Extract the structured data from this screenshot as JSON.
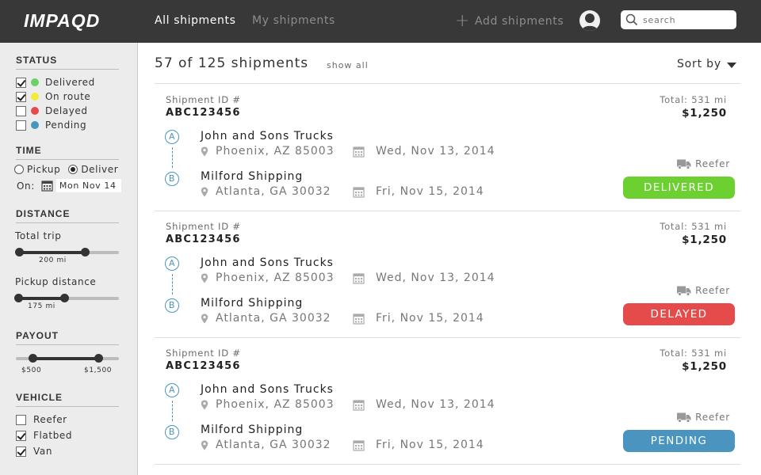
{
  "header": {
    "logo": "IMPAQD",
    "tabs": [
      {
        "label": "All shipments",
        "active": true
      },
      {
        "label": "My shipments",
        "active": false
      }
    ],
    "add_label": "Add shipments",
    "search_placeholder": "search"
  },
  "sidebar": {
    "status": {
      "heading": "STATUS",
      "items": [
        {
          "label": "Delivered",
          "checked": true,
          "color": "#6cd165"
        },
        {
          "label": "On route",
          "checked": true,
          "color": "#f3eb3a"
        },
        {
          "label": "Delayed",
          "checked": false,
          "color": "#e64b4b"
        },
        {
          "label": "Pending",
          "checked": false,
          "color": "#4a95c0"
        }
      ]
    },
    "time": {
      "heading": "TIME",
      "pickup_label": "Pickup",
      "deliver_label": "Deliver",
      "selected": "Deliver",
      "on_label": "On:",
      "date": "Mon Nov 14"
    },
    "distance": {
      "heading": "DISTANCE",
      "total_label": "Total trip",
      "total_value": "200 mi",
      "pickup_label": "Pickup distance",
      "pickup_value": "175 mi"
    },
    "payout": {
      "heading": "PAYOUT",
      "min": "$500",
      "max": "$1,500"
    },
    "vehicle": {
      "heading": "VEHICLE",
      "items": [
        {
          "label": "Reefer",
          "checked": false
        },
        {
          "label": "Flatbed",
          "checked": true
        },
        {
          "label": "Van",
          "checked": true
        }
      ]
    }
  },
  "main": {
    "count_label": "57 of 125 shipments",
    "show_all": "show all",
    "sort_label": "Sort by",
    "shipments": [
      {
        "id_label": "Shipment ID #",
        "id": "ABC123456",
        "total": "Total: 531 mi",
        "price": "$1,250",
        "pickup_marker": "A",
        "pickup_company": "John and Sons Trucks",
        "pickup_location": "Phoenix, AZ 85003",
        "pickup_date": "Wed, Nov 13, 2014",
        "drop_marker": "B",
        "drop_company": "Milford Shipping",
        "drop_location": "Atlanta, GA 30032",
        "drop_date": "Fri, Nov 15, 2014",
        "equipment": "Reefer",
        "status": "DELIVERED",
        "status_color": "#6cd130"
      },
      {
        "id_label": "Shipment ID #",
        "id": "ABC123456",
        "total": "Total: 531 mi",
        "price": "$1,250",
        "pickup_marker": "A",
        "pickup_company": "John and Sons Trucks",
        "pickup_location": "Phoenix, AZ 85003",
        "pickup_date": "Wed, Nov 13, 2014",
        "drop_marker": "B",
        "drop_company": "Milford Shipping",
        "drop_location": "Atlanta, GA 30032",
        "drop_date": "Fri, Nov 15, 2014",
        "equipment": "Reefer",
        "status": "DELAYED",
        "status_color": "#e64b4b"
      },
      {
        "id_label": "Shipment ID #",
        "id": "ABC123456",
        "total": "Total: 531 mi",
        "price": "$1,250",
        "pickup_marker": "A",
        "pickup_company": "John and Sons Trucks",
        "pickup_location": "Phoenix, AZ 85003",
        "pickup_date": "Wed, Nov 13, 2014",
        "drop_marker": "B",
        "drop_company": "Milford Shipping",
        "drop_location": "Atlanta, GA 30032",
        "drop_date": "Fri, Nov 15, 2014",
        "equipment": "Reefer",
        "status": "PENDING",
        "status_color": "#4a95c0"
      }
    ]
  }
}
